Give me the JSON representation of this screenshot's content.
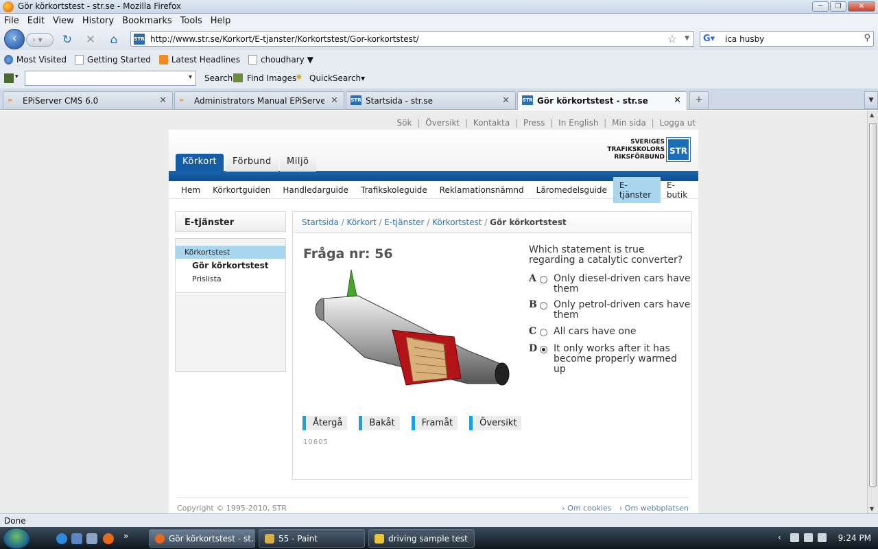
{
  "window": {
    "title": "Gör körkortstest - str.se - Mozilla Firefox"
  },
  "menu": [
    "File",
    "Edit",
    "View",
    "History",
    "Bookmarks",
    "Tools",
    "Help"
  ],
  "nav": {
    "url": "http://www.str.se/Korkort/E-tjanster/Korkortstest/Gor-korkortstest/",
    "search_value": "ica husby"
  },
  "bookmarks": [
    "Most Visited",
    "Getting Started",
    "Latest Headlines",
    "choudhary ▼"
  ],
  "toolbar": {
    "search": "Search",
    "find_images": "Find Images",
    "quicksearch": "QuickSearch▾"
  },
  "tabs": [
    {
      "label": "EPiServer CMS 6.0"
    },
    {
      "label": "Administrators Manual EPiServer C..."
    },
    {
      "label": "Startsida - str.se"
    },
    {
      "label": "Gör körkortstest - str.se"
    }
  ],
  "site": {
    "toplinks": [
      "Sök",
      "Översikt",
      "Kontakta",
      "Press",
      "In English",
      "Min sida",
      "Logga ut"
    ],
    "logo": {
      "line1": "SVERIGES",
      "line2": "TRAFIKSKOLORS",
      "line3": "RIKSFÖRBUND",
      "badge": "STR"
    },
    "main_tabs": [
      "Körkort",
      "Förbund",
      "Miljö"
    ],
    "subnav": [
      "Hem",
      "Körkortguiden",
      "Handledarguide",
      "Trafikskoleguide",
      "Reklamationsnämnd",
      "Läromedelsguide",
      "E-tjänster",
      "E-butik"
    ],
    "left": {
      "heading": "E-tjänster",
      "section": "Körkortstest",
      "items": [
        "Gör körkortstest",
        "Prislista"
      ]
    },
    "breadcrumb": {
      "items": [
        "Startsida",
        "Körkort",
        "E-tjänster",
        "Körkortstest"
      ],
      "current": "Gör körkortstest"
    },
    "question": {
      "title": "Fråga nr: 56",
      "text": "Which statement is true regarding a catalytic converter?",
      "options": [
        {
          "letter": "A",
          "text": "Only diesel-driven cars have them",
          "selected": false
        },
        {
          "letter": "B",
          "text": "Only petrol-driven cars have them",
          "selected": false
        },
        {
          "letter": "C",
          "text": "All cars have one",
          "selected": false
        },
        {
          "letter": "D",
          "text": "It only works after it has become properly warmed up",
          "selected": true
        }
      ],
      "id": "10605"
    },
    "buttons": [
      "Återgå",
      "Bakåt",
      "Framåt",
      "Översikt"
    ],
    "footer": {
      "copyright": "Copyright © 1995-2010, STR",
      "links": [
        "Om cookies",
        "Om webbplatsen"
      ]
    }
  },
  "status": "Done",
  "taskbar": {
    "items": [
      "Gör körkortstest - st...",
      "55 - Paint",
      "driving sample test"
    ],
    "clock": "9:24 PM"
  }
}
